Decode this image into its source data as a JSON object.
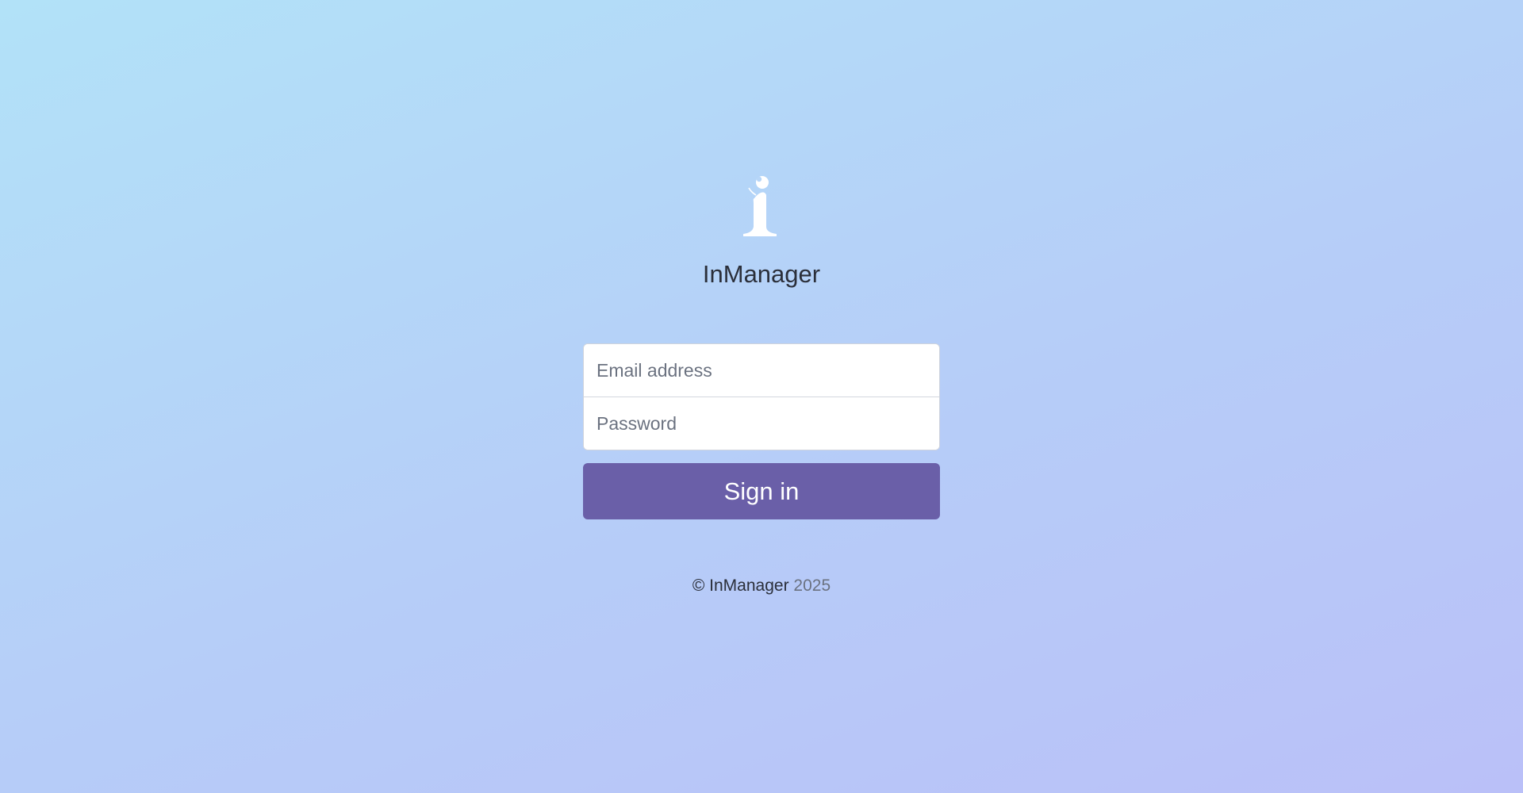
{
  "app": {
    "logo_icon": "inmanager-i-logo-icon",
    "name": "InManager"
  },
  "form": {
    "email_placeholder": "Email address",
    "password_placeholder": "Password",
    "signin_label": "Sign in"
  },
  "footer": {
    "copyright_symbol": "©",
    "brand": "InManager",
    "year": "2025"
  },
  "colors": {
    "accent": "#6a5fa8",
    "background_start": "#b2e2f8",
    "background_end": "#bac0f8"
  }
}
